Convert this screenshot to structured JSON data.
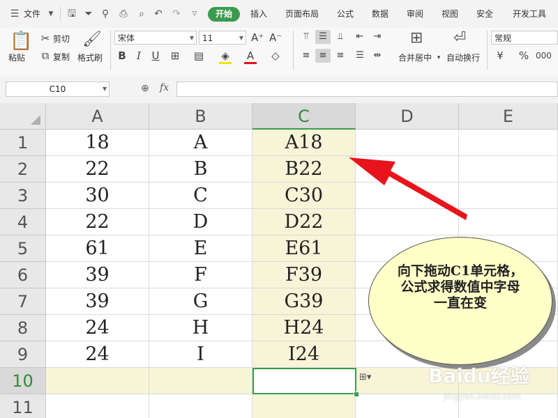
{
  "menubar": {
    "file_label": "文件",
    "tabs": [
      "开始",
      "插入",
      "页面布局",
      "公式",
      "数据",
      "审阅",
      "视图",
      "安全",
      "开发工具"
    ]
  },
  "ribbon": {
    "paste": "粘贴",
    "cut": "剪切",
    "copy": "复制",
    "format_painter": "格式刷",
    "font_name": "宋体",
    "font_size": "11",
    "merge_center": "合并居中",
    "wrap_text": "自动换行",
    "number_format": "常规"
  },
  "formula_bar": {
    "name_box": "C10",
    "fx": "fx",
    "formula": ""
  },
  "sheet": {
    "columns": [
      "A",
      "B",
      "C",
      "D",
      "E"
    ],
    "selected_column": "C",
    "selected_row": 10,
    "rows": [
      {
        "n": "1",
        "a": "18",
        "b": "A",
        "c": "A18"
      },
      {
        "n": "2",
        "a": "22",
        "b": "B",
        "c": "B22"
      },
      {
        "n": "3",
        "a": "30",
        "b": "C",
        "c": "C30"
      },
      {
        "n": "4",
        "a": "22",
        "b": "D",
        "c": "D22"
      },
      {
        "n": "5",
        "a": "61",
        "b": "E",
        "c": "E61"
      },
      {
        "n": "6",
        "a": "39",
        "b": "F",
        "c": "F39"
      },
      {
        "n": "7",
        "a": "39",
        "b": "G",
        "c": "G39"
      },
      {
        "n": "8",
        "a": "24",
        "b": "H",
        "c": "H24"
      },
      {
        "n": "9",
        "a": "24",
        "b": "I",
        "c": "I24"
      },
      {
        "n": "10",
        "a": "",
        "b": "",
        "c": ""
      },
      {
        "n": "11",
        "a": "",
        "b": "",
        "c": ""
      }
    ]
  },
  "annotation": {
    "text": "向下拖动C1单元格，公式求得数值中字母一直在变"
  },
  "watermark": {
    "logo": "Baidu经验",
    "url": "jingyan.baidu.com"
  },
  "colors": {
    "accent_green": "#3a9b4f",
    "highlight_yellow": "#f7f4d8",
    "arrow_red": "#e8141b",
    "bubble_fill": "#ffffc8"
  }
}
